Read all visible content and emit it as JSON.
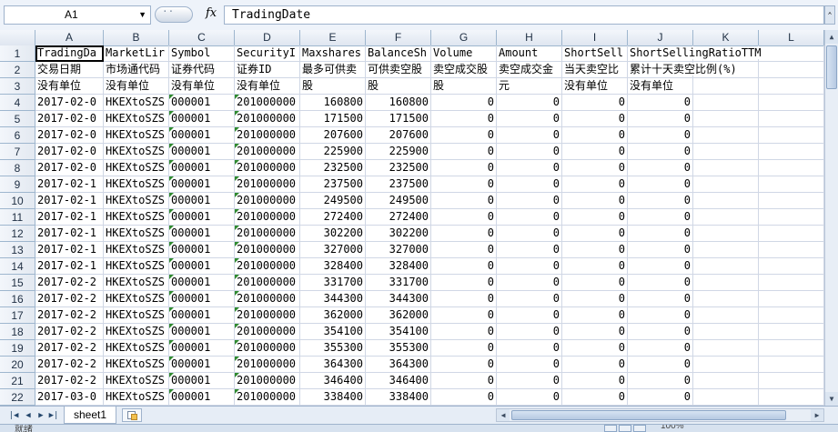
{
  "formula_bar": {
    "name_box": "A1",
    "fx_label": "fx",
    "content": "TradingDate"
  },
  "columns": [
    "A",
    "B",
    "C",
    "D",
    "E",
    "F",
    "G",
    "H",
    "I",
    "J",
    "K",
    "L"
  ],
  "row_numbers": [
    "1",
    "2",
    "3",
    "4",
    "5",
    "6",
    "7",
    "8",
    "9",
    "10",
    "11",
    "12",
    "13",
    "14",
    "15",
    "16",
    "17",
    "18",
    "19",
    "20",
    "21",
    "22"
  ],
  "rows": [
    [
      "TradingDa",
      "MarketLir",
      "Symbol",
      "SecurityI",
      "Maxshares",
      "BalanceSh",
      "Volume",
      "Amount",
      "ShortSell",
      "ShortSellingRatioTTM",
      "",
      ""
    ],
    [
      "交易日期",
      "市场通代码",
      "证券代码",
      "证券ID",
      "最多可供卖",
      "可供卖空股",
      "卖空成交股",
      "卖空成交金",
      "当天卖空比",
      "累计十天卖空比例(%)",
      "",
      ""
    ],
    [
      "没有单位",
      "没有单位",
      "没有单位",
      "没有单位",
      "股",
      "股",
      "股",
      "元",
      "没有单位",
      "没有单位",
      "",
      ""
    ],
    [
      "2017-02-0",
      "HKEXtoSZS",
      "000001",
      "201000000",
      "160800",
      "160800",
      "0",
      "0",
      "0",
      "0",
      "",
      ""
    ],
    [
      "2017-02-0",
      "HKEXtoSZS",
      "000001",
      "201000000",
      "171500",
      "171500",
      "0",
      "0",
      "0",
      "0",
      "",
      ""
    ],
    [
      "2017-02-0",
      "HKEXtoSZS",
      "000001",
      "201000000",
      "207600",
      "207600",
      "0",
      "0",
      "0",
      "0",
      "",
      ""
    ],
    [
      "2017-02-0",
      "HKEXtoSZS",
      "000001",
      "201000000",
      "225900",
      "225900",
      "0",
      "0",
      "0",
      "0",
      "",
      ""
    ],
    [
      "2017-02-0",
      "HKEXtoSZS",
      "000001",
      "201000000",
      "232500",
      "232500",
      "0",
      "0",
      "0",
      "0",
      "",
      ""
    ],
    [
      "2017-02-1",
      "HKEXtoSZS",
      "000001",
      "201000000",
      "237500",
      "237500",
      "0",
      "0",
      "0",
      "0",
      "",
      ""
    ],
    [
      "2017-02-1",
      "HKEXtoSZS",
      "000001",
      "201000000",
      "249500",
      "249500",
      "0",
      "0",
      "0",
      "0",
      "",
      ""
    ],
    [
      "2017-02-1",
      "HKEXtoSZS",
      "000001",
      "201000000",
      "272400",
      "272400",
      "0",
      "0",
      "0",
      "0",
      "",
      ""
    ],
    [
      "2017-02-1",
      "HKEXtoSZS",
      "000001",
      "201000000",
      "302200",
      "302200",
      "0",
      "0",
      "0",
      "0",
      "",
      ""
    ],
    [
      "2017-02-1",
      "HKEXtoSZS",
      "000001",
      "201000000",
      "327000",
      "327000",
      "0",
      "0",
      "0",
      "0",
      "",
      ""
    ],
    [
      "2017-02-1",
      "HKEXtoSZS",
      "000001",
      "201000000",
      "328400",
      "328400",
      "0",
      "0",
      "0",
      "0",
      "",
      ""
    ],
    [
      "2017-02-2",
      "HKEXtoSZS",
      "000001",
      "201000000",
      "331700",
      "331700",
      "0",
      "0",
      "0",
      "0",
      "",
      ""
    ],
    [
      "2017-02-2",
      "HKEXtoSZS",
      "000001",
      "201000000",
      "344300",
      "344300",
      "0",
      "0",
      "0",
      "0",
      "",
      ""
    ],
    [
      "2017-02-2",
      "HKEXtoSZS",
      "000001",
      "201000000",
      "362000",
      "362000",
      "0",
      "0",
      "0",
      "0",
      "",
      ""
    ],
    [
      "2017-02-2",
      "HKEXtoSZS",
      "000001",
      "201000000",
      "354100",
      "354100",
      "0",
      "0",
      "0",
      "0",
      "",
      ""
    ],
    [
      "2017-02-2",
      "HKEXtoSZS",
      "000001",
      "201000000",
      "355300",
      "355300",
      "0",
      "0",
      "0",
      "0",
      "",
      ""
    ],
    [
      "2017-02-2",
      "HKEXtoSZS",
      "000001",
      "201000000",
      "364300",
      "364300",
      "0",
      "0",
      "0",
      "0",
      "",
      ""
    ],
    [
      "2017-02-2",
      "HKEXtoSZS",
      "000001",
      "201000000",
      "346400",
      "346400",
      "0",
      "0",
      "0",
      "0",
      "",
      ""
    ],
    [
      "2017-03-0",
      "HKEXtoSZS",
      "000001",
      "201000000",
      "338400",
      "338400",
      "0",
      "0",
      "0",
      "0",
      "",
      ""
    ]
  ],
  "sheet_tabs": [
    "sheet1"
  ],
  "status": {
    "text": "就绪",
    "zoom": "100%"
  }
}
